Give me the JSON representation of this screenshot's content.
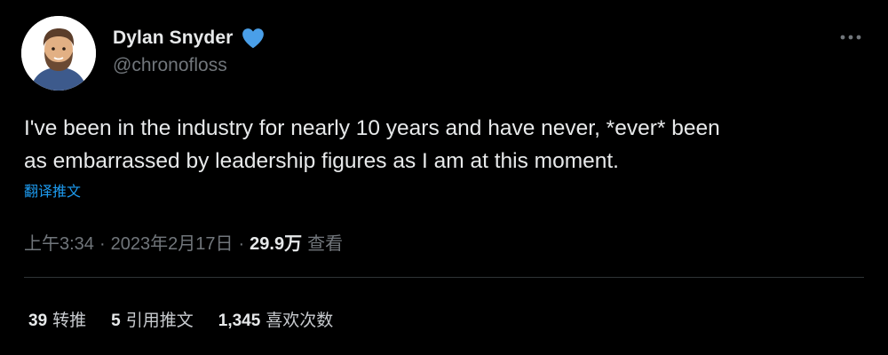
{
  "author": {
    "display_name": "Dylan Snyder",
    "handle": "@chronofloss",
    "verified_badge_color": "#1d9bf0",
    "avatar_icon": "bearded-man-avatar"
  },
  "tweet": {
    "text": "I've been in the industry for nearly 10 years and have never, *ever* been\nas embarrassed by leadership figures as I am at this moment.",
    "translate_label": "翻译推文",
    "time": "上午3:34",
    "separator": "·",
    "date": "2023年2月17日",
    "views_count": "29.9万",
    "views_label": "查看"
  },
  "stats": {
    "retweets_count": "39",
    "retweets_label": "转推",
    "quotes_count": "5",
    "quotes_label": "引用推文",
    "likes_count": "1,345",
    "likes_label": "喜欢次数"
  },
  "icons": {
    "more": "more-horizontal-icon",
    "verified": "verified-badge-icon"
  },
  "colors": {
    "background": "#000000",
    "text_primary": "#e7e9ea",
    "text_secondary": "#71767b",
    "accent": "#1d9bf0",
    "divider": "#2f3336"
  }
}
